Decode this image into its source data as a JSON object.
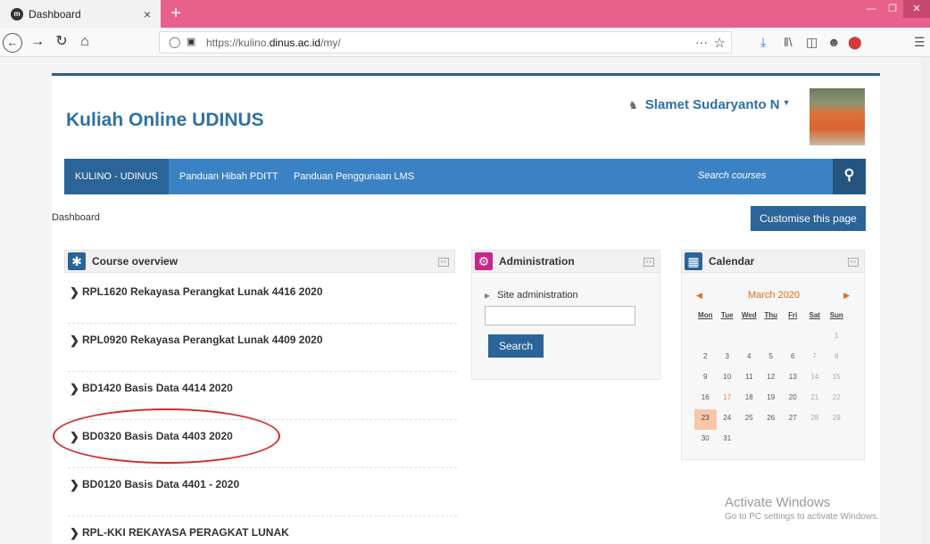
{
  "browser": {
    "tab_title": "Dashboard",
    "tab_close": "×",
    "new_tab": "+",
    "url_prefix": "https://kulino.",
    "url_domain": "dinus.ac.id",
    "url_suffix": "/my/",
    "url_more": "···"
  },
  "site": {
    "name": "Kuliah Online UDINUS"
  },
  "user": {
    "name": "Slamet Sudaryanto N"
  },
  "nav": {
    "items": [
      "KULINO - UDINUS",
      "Panduan Hibah PDITT",
      "Panduan Penggunaan LMS"
    ],
    "search_placeholder": "Search courses"
  },
  "breadcrumb": "Dashboard",
  "customise_label": "Customise this page",
  "course_overview": {
    "title": "Course overview",
    "courses": [
      "RPL1620 Rekayasa Perangkat Lunak 4416 2020",
      "RPL0920 Rekayasa Perangkat Lunak 4409 2020",
      "BD1420 Basis Data 4414 2020",
      "BD0320 Basis Data 4403 2020",
      "BD0120 Basis Data 4401 - 2020",
      "RPL-KKI REKAYASA PERAGKAT LUNAK"
    ]
  },
  "administration": {
    "title": "Administration",
    "site_admin": "Site administration",
    "search_label": "Search"
  },
  "calendar": {
    "title": "Calendar",
    "month": "March 2020",
    "days": [
      "Mon",
      "Tue",
      "Wed",
      "Thu",
      "Fri",
      "Sat",
      "Sun"
    ],
    "weeks": [
      [
        "",
        "",
        "",
        "",
        "",
        "",
        "1"
      ],
      [
        "2",
        "3",
        "4",
        "5",
        "6",
        "7",
        "8"
      ],
      [
        "9",
        "10",
        "11",
        "12",
        "13",
        "14",
        "15"
      ],
      [
        "16",
        "17",
        "18",
        "19",
        "20",
        "21",
        "22"
      ],
      [
        "23",
        "24",
        "25",
        "26",
        "27",
        "28",
        "29"
      ],
      [
        "30",
        "31",
        "",
        "",
        "",
        "",
        ""
      ]
    ],
    "today": "23",
    "holiday": "17"
  },
  "watermark": {
    "title": "Activate Windows",
    "subtitle": "Go to PC settings to activate Windows."
  },
  "colors": {
    "titlebar": "#e8608c",
    "nav_bar": "#3a82c4",
    "primary_button": "#2a6499",
    "site_name": "#2f71a2",
    "highlight_circle": "#d12a2a",
    "calendar_accent": "#e06c16"
  }
}
